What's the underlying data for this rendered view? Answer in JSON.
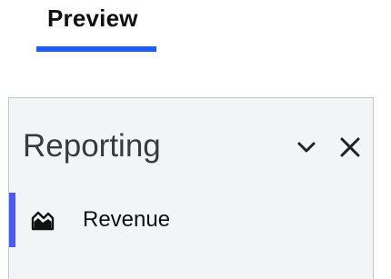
{
  "tabs": {
    "preview_label": "Preview",
    "active_color": "#1a5cff"
  },
  "panel": {
    "title": "Reporting",
    "collapse_icon": "chevron-down-icon",
    "close_icon": "close-icon",
    "items": [
      {
        "label": "Revenue",
        "icon": "area-chart-icon",
        "active": true
      }
    ],
    "active_indicator_color": "#4b5bf0"
  }
}
